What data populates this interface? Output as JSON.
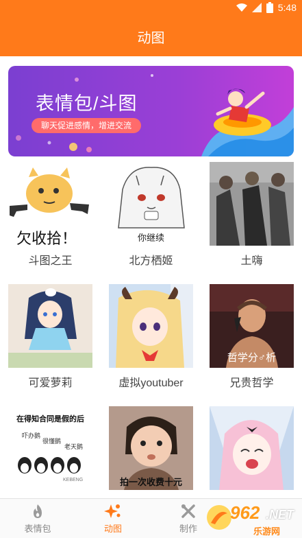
{
  "status_bar": {
    "time": "5:48",
    "battery_level": "5"
  },
  "header": {
    "title": "动图"
  },
  "banner": {
    "title": "表情包/斗图",
    "subtitle": "聊天促进感情，增进交流"
  },
  "grid": {
    "items": [
      {
        "label": "斗图之王",
        "caption": "欠收拾！"
      },
      {
        "label": "北方栖姬",
        "caption": "你继续"
      },
      {
        "label": "土嗨",
        "caption": ""
      },
      {
        "label": "可爱萝莉",
        "caption": ""
      },
      {
        "label": "虚拟youtuber",
        "caption": ""
      },
      {
        "label": "兄贵哲学",
        "caption": "哲学分♂析"
      },
      {
        "label": "",
        "caption": "在得知合同是假的后"
      },
      {
        "label": "",
        "caption": "拍一次收费十元"
      },
      {
        "label": "",
        "caption": ""
      }
    ],
    "extra_texts": {
      "p1": "吓办鹅",
      "p2": "很懂鹅",
      "p3": "老天鹅",
      "brand": "KEBENG"
    }
  },
  "bottom_nav": {
    "items": [
      {
        "label": "表情包",
        "icon": "flame-icon",
        "active": false
      },
      {
        "label": "动图",
        "icon": "sparkle-icon",
        "active": true
      },
      {
        "label": "制作",
        "icon": "tools-icon",
        "active": false
      }
    ]
  },
  "watermark": {
    "text": "962",
    "suffix": ".NET",
    "sub": "乐游网"
  },
  "colors": {
    "accent": "#ff7a1a",
    "banner_start": "#7b3fd1",
    "banner_end": "#c23fd8"
  }
}
